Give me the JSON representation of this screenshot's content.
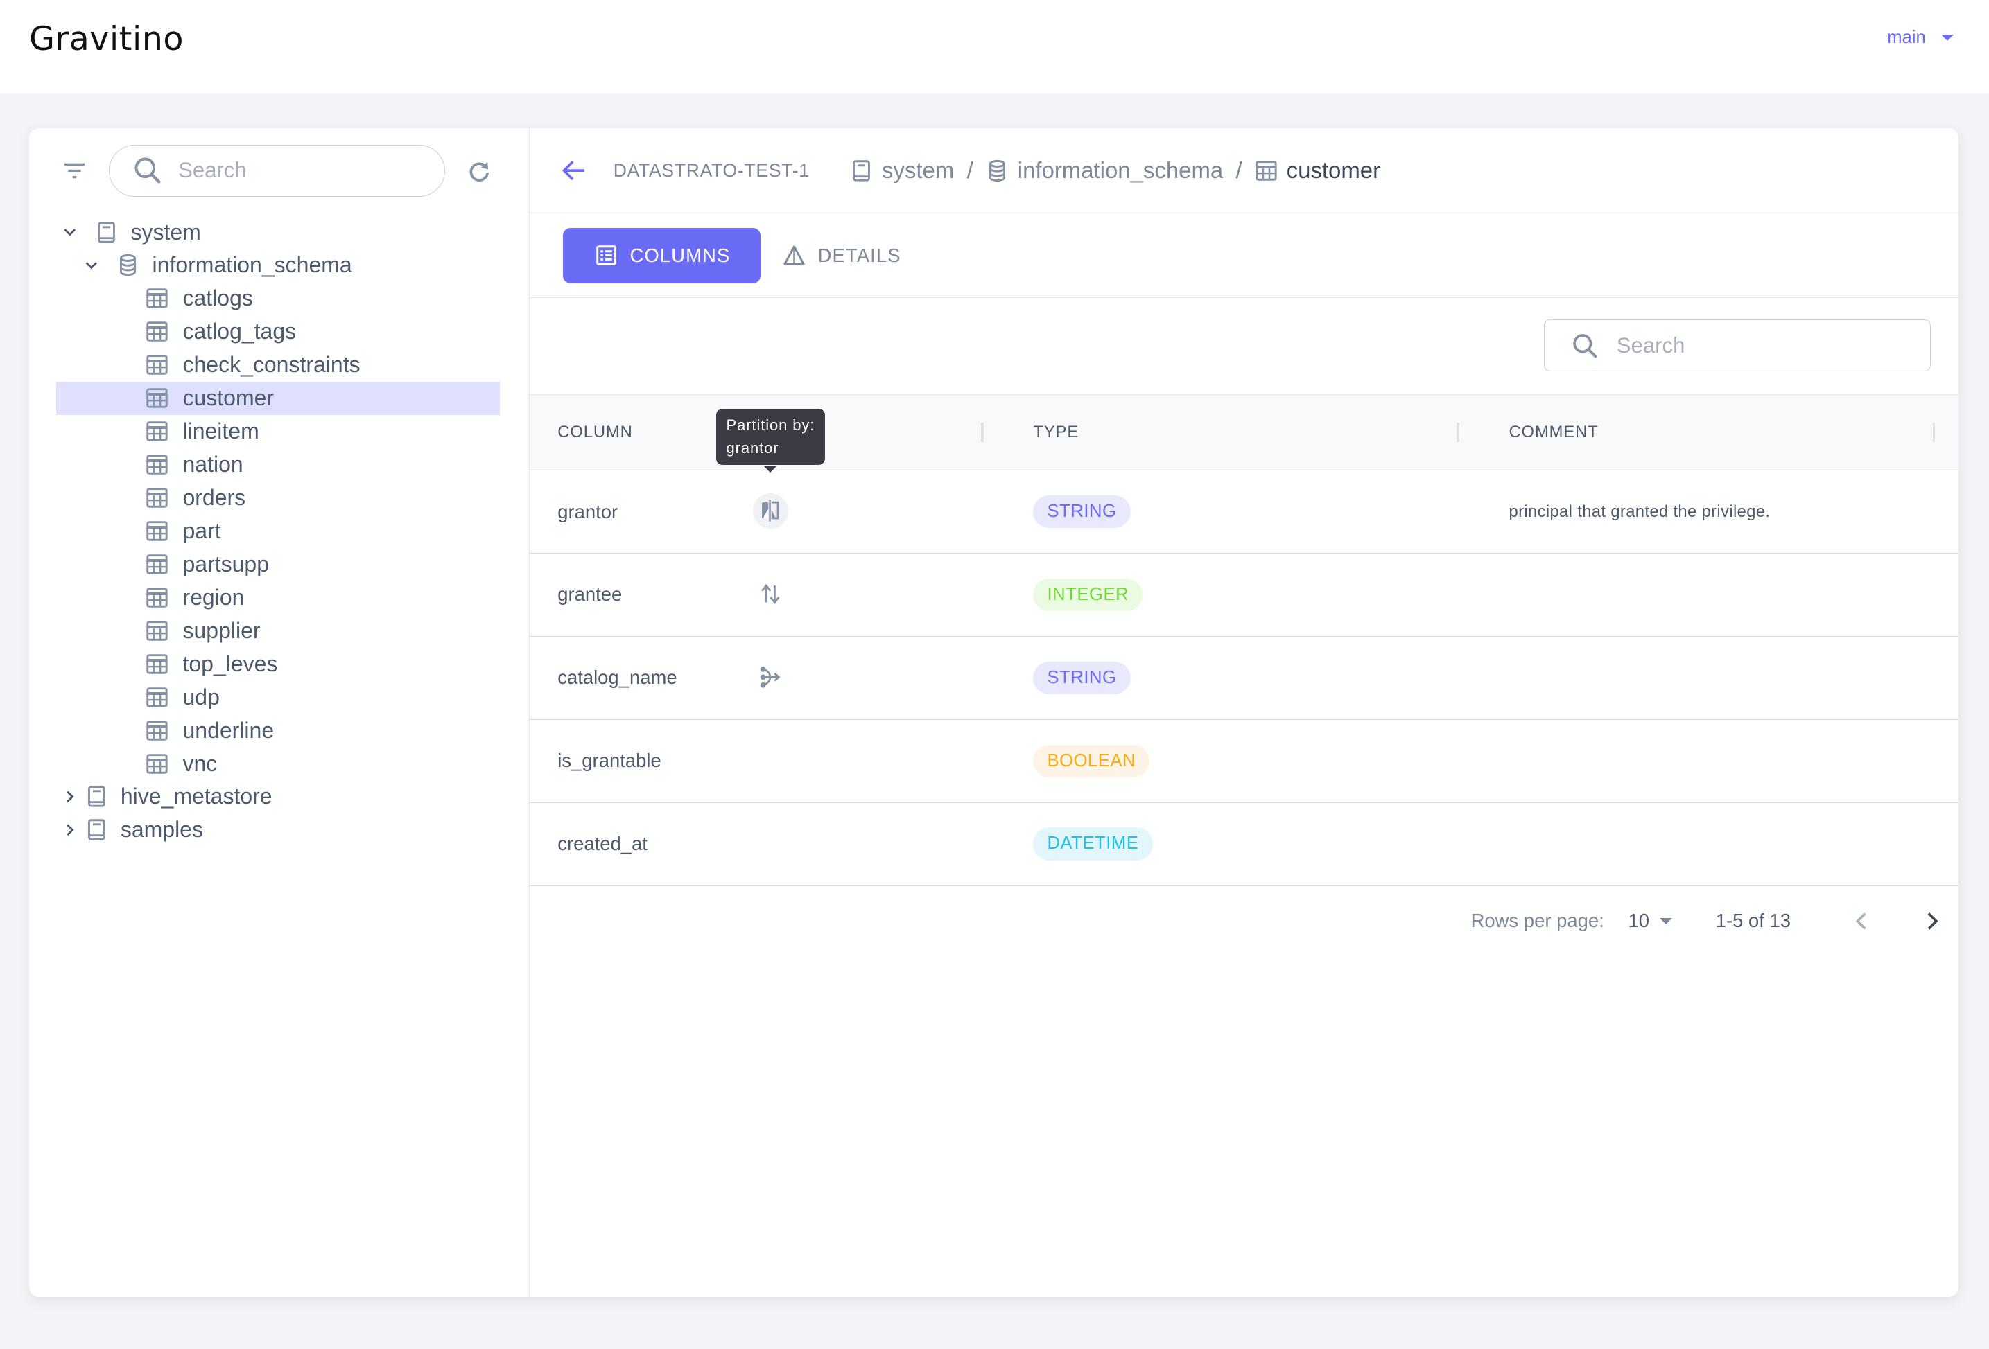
{
  "app": {
    "logo": "Gravitino",
    "version_selector": "main"
  },
  "colors": {
    "accent": "#6a6cf6",
    "selected_row_bg": "#dfe0fd",
    "tooltip_bg": "#3a3b45"
  },
  "sidebar": {
    "search_placeholder": "Search",
    "tree": [
      {
        "label": "system",
        "type": "catalog",
        "level": 0,
        "expanded": true
      },
      {
        "label": "information_schema",
        "type": "schema",
        "level": 1,
        "expanded": true
      },
      {
        "label": "catlogs",
        "type": "table",
        "level": 2
      },
      {
        "label": "catlog_tags",
        "type": "table",
        "level": 2
      },
      {
        "label": "check_constraints",
        "type": "table",
        "level": 2
      },
      {
        "label": "customer",
        "type": "table",
        "level": 2,
        "selected": true
      },
      {
        "label": "lineitem",
        "type": "table",
        "level": 2
      },
      {
        "label": "nation",
        "type": "table",
        "level": 2
      },
      {
        "label": "orders",
        "type": "table",
        "level": 2
      },
      {
        "label": "part",
        "type": "table",
        "level": 2
      },
      {
        "label": "partsupp",
        "type": "table",
        "level": 2
      },
      {
        "label": "region",
        "type": "table",
        "level": 2
      },
      {
        "label": "supplier",
        "type": "table",
        "level": 2
      },
      {
        "label": "top_leves",
        "type": "table",
        "level": 2
      },
      {
        "label": "udp",
        "type": "table",
        "level": 2
      },
      {
        "label": "underline",
        "type": "table",
        "level": 2
      },
      {
        "label": "vnc",
        "type": "table",
        "level": 2
      },
      {
        "label": "hive_metastore",
        "type": "catalog",
        "level": 0,
        "expanded": false
      },
      {
        "label": "samples",
        "type": "catalog",
        "level": 0,
        "expanded": false
      }
    ]
  },
  "breadcrumb": {
    "metalake": "DATASTRATO-TEST-1",
    "items": [
      {
        "label": "system",
        "icon": "catalog-icon"
      },
      {
        "label": "information_schema",
        "icon": "schema-icon"
      },
      {
        "label": "customer",
        "icon": "table-icon"
      }
    ],
    "separator": "/"
  },
  "tabs": [
    {
      "label": "COLUMNS",
      "icon": "list-icon",
      "active": true
    },
    {
      "label": "DETAILS",
      "icon": "details-icon",
      "active": false
    }
  ],
  "table": {
    "search_placeholder": "Search",
    "headers": {
      "column": "COLUMN",
      "type": "TYPE",
      "comment": "COMMENT"
    },
    "tooltip": {
      "line1": "Partition by:",
      "line2": "grantor"
    },
    "rows": [
      {
        "name": "grantor",
        "indicator": "partition-icon",
        "type": "STRING",
        "comment": "principal that granted the privilege."
      },
      {
        "name": "grantee",
        "indicator": "sort-icon",
        "type": "INTEGER",
        "comment": ""
      },
      {
        "name": "catalog_name",
        "indicator": "distribution-icon",
        "type": "STRING",
        "comment": ""
      },
      {
        "name": "is_grantable",
        "indicator": "",
        "type": "BOOLEAN",
        "comment": ""
      },
      {
        "name": "created_at",
        "indicator": "",
        "type": "DATETIME",
        "comment": ""
      }
    ],
    "type_colors": {
      "STRING": {
        "fg": "#6a6cf6",
        "bg": "#e9e9fd"
      },
      "INTEGER": {
        "fg": "#72d43f",
        "bg": "#eafbe1"
      },
      "BOOLEAN": {
        "fg": "#fdaa15",
        "bg": "#fdf4e5"
      },
      "DATETIME": {
        "fg": "#1bc2eb",
        "bg": "#e2f6fc"
      }
    }
  },
  "pagination": {
    "rows_per_page_label": "Rows per page:",
    "rows_per_page": "10",
    "range": "1-5 of 13"
  }
}
